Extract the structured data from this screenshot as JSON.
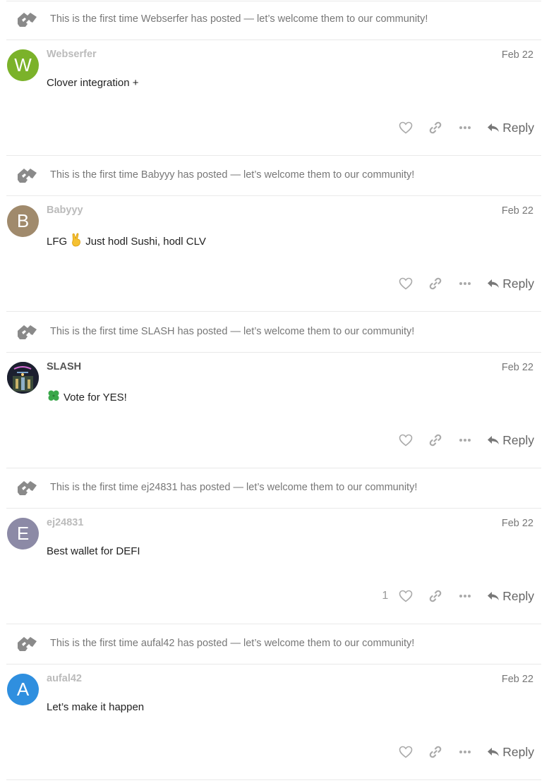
{
  "posts": [
    {
      "notice": "This is the first time Webserfer has posted — let’s welcome them to our community!",
      "avatar_letter": "W",
      "avatar_color": "#7bb22a",
      "username": "Webserfer",
      "date": "Feb 22",
      "body_pre": "Clover integration +",
      "body_post": "",
      "emoji": "",
      "like_count": "",
      "reply_label": "Reply"
    },
    {
      "notice": "This is the first time Babyyy has posted — let’s welcome them to our community!",
      "avatar_letter": "B",
      "avatar_color": "#a08a6c",
      "username": "Babyyy",
      "date": "Feb 22",
      "body_pre": "LFG",
      "body_post": "Just hodl Sushi, hodl CLV",
      "emoji": "victory-hand",
      "like_count": "",
      "reply_label": "Reply"
    },
    {
      "notice": "This is the first time SLASH has posted — let’s welcome them to our community!",
      "avatar_letter": "",
      "avatar_color": "#1c2030",
      "username": "SLASH",
      "date": "Feb 22",
      "body_pre": "",
      "body_post": "Vote for YES!",
      "emoji": "four-leaf-clover",
      "like_count": "",
      "reply_label": "Reply"
    },
    {
      "notice": "This is the first time ej24831 has posted — let’s welcome them to our community!",
      "avatar_letter": "E",
      "avatar_color": "#8c8aa6",
      "username": "ej24831",
      "date": "Feb 22",
      "body_pre": "Best wallet for DEFI",
      "body_post": "",
      "emoji": "",
      "like_count": "1",
      "reply_label": "Reply"
    },
    {
      "notice": "This is the first time aufal42 has posted — let’s welcome them to our community!",
      "avatar_letter": "A",
      "avatar_color": "#2f8fdf",
      "username": "aufal42",
      "date": "Feb 22",
      "body_pre": "Let’s make it happen",
      "body_post": "",
      "emoji": "",
      "like_count": "",
      "reply_label": "Reply"
    }
  ]
}
